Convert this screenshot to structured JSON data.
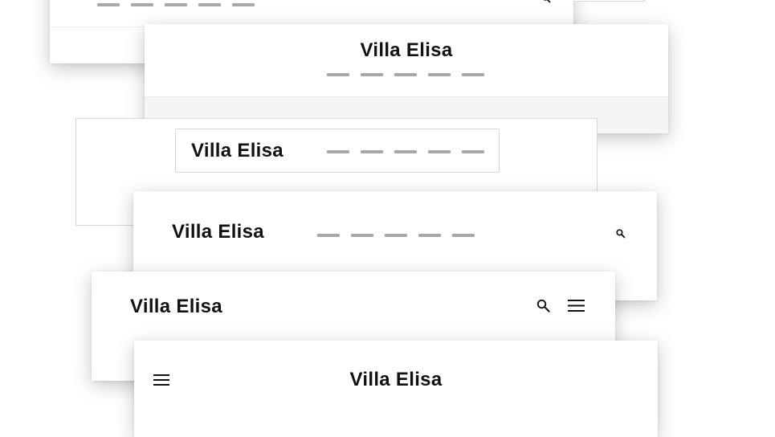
{
  "brand": {
    "name": "Villa Elisa"
  },
  "icons": {
    "search": "search-icon",
    "menu": "hamburger-menu-icon"
  },
  "colors": {
    "logo_text": "#111111",
    "nav_placeholder": "#a9a9a9",
    "card_background": "#ffffff",
    "band_background": "#f5f5f5"
  }
}
